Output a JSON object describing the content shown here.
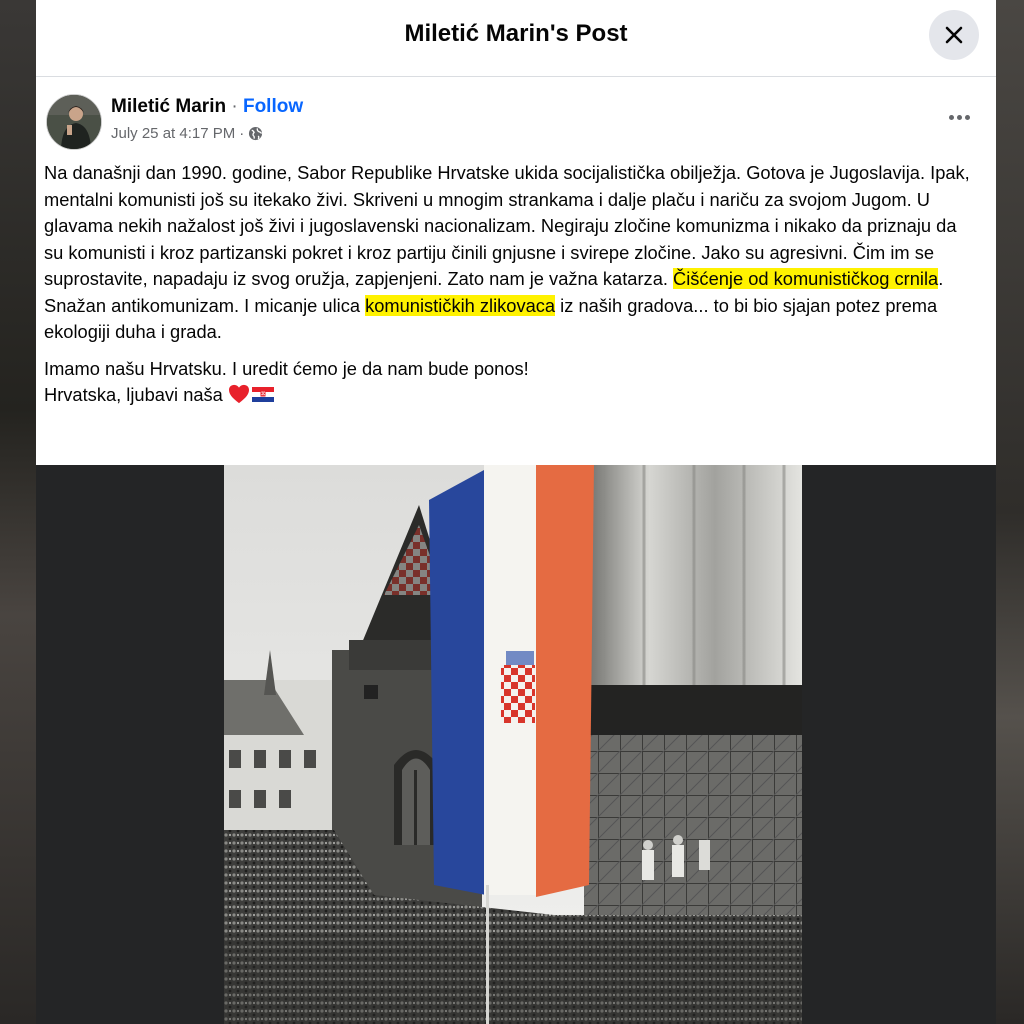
{
  "header": {
    "title": "Miletić Marin's Post",
    "close_icon": "close-icon"
  },
  "post": {
    "author": "Miletić Marin",
    "separator": " · ",
    "follow_label": "Follow",
    "timestamp": "July 25 at 4:17 PM",
    "audience_icon": "globe-icon",
    "more_icon": "ellipsis-icon",
    "text": {
      "p1_a": "Na današnji dan 1990. godine, Sabor Republike Hrvatske ukida socijalistička obilježja. Gotova je Jugoslavija. Ipak, mentalni komunisti još su itekako živi. Skriveni u mnogim strankama i dalje plaču i nariču za svojom Jugom. U glavama nekih nažalost još živi i jugoslavenski nacionalizam. Negiraju zločine komunizma i nikako da priznaju da su komunisti i kroz partizanski pokret i kroz partiju činili gnjusne i svirepe zločine. Jako su agresivni. Čim im se suprostavite, napadaju iz svog oružja, zapjenjeni. Zato nam je važna katarza. ",
      "highlight_1": "Čišćenje od komunističkog crnila",
      "p1_b": ". Snažan antikomunizam. I micanje ulica ",
      "highlight_2": "komunističkih zlikovaca",
      "p1_c": " iz naših gradova... to bi bio sjajan potez prema ekologiji duha i grada.",
      "p2_line1": "Imamo našu Hrvatsku. I uredit ćemo je da nam bude ponos!",
      "p2_line2": "Hrvatska, ljubavi naša",
      "emoji": [
        "red-heart-icon",
        "croatia-flag-icon"
      ]
    }
  },
  "colors": {
    "follow": "#0866ff",
    "highlight": "#fff200",
    "modal_bg": "#242526"
  }
}
